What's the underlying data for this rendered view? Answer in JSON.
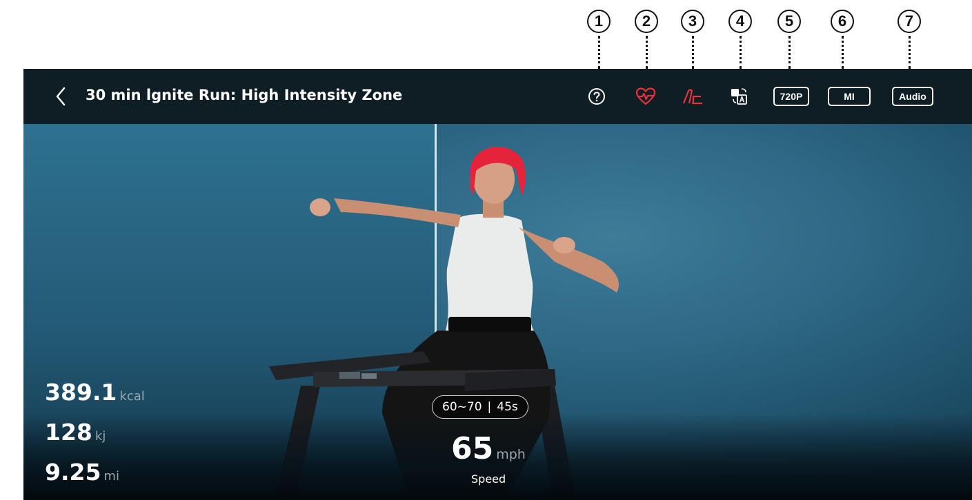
{
  "callouts": [
    "1",
    "2",
    "3",
    "4",
    "5",
    "6",
    "7"
  ],
  "header": {
    "title": "30 min lgnite Run: High Intensity Zone",
    "back_icon": "chevron-left-icon",
    "icons": [
      "help-icon",
      "heart-rate-icon",
      "incline-icon",
      "subtitle-translate-icon"
    ],
    "quality_label": "720P",
    "unit_label": "MI",
    "audio_label": "Audio"
  },
  "colors": {
    "accent": "#e8323c",
    "topbar": "#0f1d25",
    "text": "#ffffff",
    "unit_text": "#9aa7ad"
  },
  "stats": {
    "calories": {
      "value": "389.1",
      "unit": "kcal"
    },
    "energy": {
      "value": "128",
      "unit": "kj"
    },
    "distance": {
      "value": "9.25",
      "unit": "mi"
    }
  },
  "zone": {
    "range": "60~70",
    "separator": "|",
    "time": "45s"
  },
  "speed": {
    "value": "65",
    "unit": "mph",
    "label": "Speed"
  }
}
